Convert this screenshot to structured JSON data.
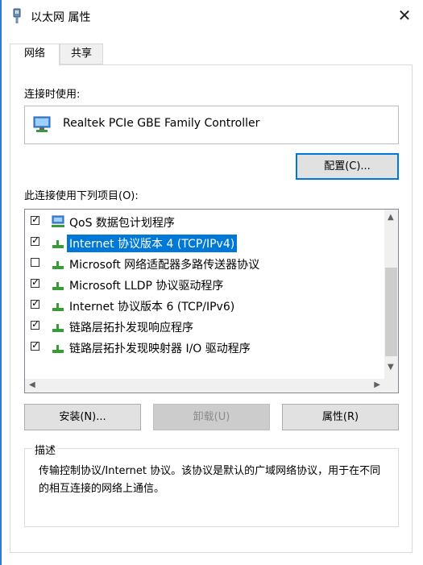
{
  "window": {
    "title": "以太网 属性",
    "close_glyph": "✕"
  },
  "tabs": [
    {
      "label": "网络",
      "active": true
    },
    {
      "label": "共享",
      "active": false
    }
  ],
  "connect_using_label": "连接时使用:",
  "adapter": {
    "name": "Realtek PCIe GBE Family Controller",
    "icon": "network-adapter-icon"
  },
  "configure_button": "配置(C)...",
  "items_label": "此连接使用下列项目(O):",
  "items": [
    {
      "label": "QoS 数据包计划程序",
      "checked": true,
      "selected": false,
      "icon": "qos-icon"
    },
    {
      "label": "Internet 协议版本 4 (TCP/IPv4)",
      "checked": true,
      "selected": true,
      "icon": "protocol-icon"
    },
    {
      "label": "Microsoft 网络适配器多路传送器协议",
      "checked": false,
      "selected": false,
      "icon": "protocol-icon"
    },
    {
      "label": "Microsoft LLDP 协议驱动程序",
      "checked": true,
      "selected": false,
      "icon": "protocol-icon"
    },
    {
      "label": "Internet 协议版本 6 (TCP/IPv6)",
      "checked": true,
      "selected": false,
      "icon": "protocol-icon"
    },
    {
      "label": "链路层拓扑发现响应程序",
      "checked": true,
      "selected": false,
      "icon": "protocol-icon"
    },
    {
      "label": "链路层拓扑发现映射器 I/O 驱动程序",
      "checked": true,
      "selected": false,
      "icon": "protocol-icon"
    }
  ],
  "buttons": {
    "install": "安装(N)...",
    "uninstall": "卸载(U)",
    "properties": "属性(R)"
  },
  "description": {
    "title": "描述",
    "text": "传输控制协议/Internet 协议。该协议是默认的广域网络协议，用于在不同的相互连接的网络上通信。"
  },
  "colors": {
    "accent": "#0078d7",
    "window_border": "#2f7bd1"
  }
}
